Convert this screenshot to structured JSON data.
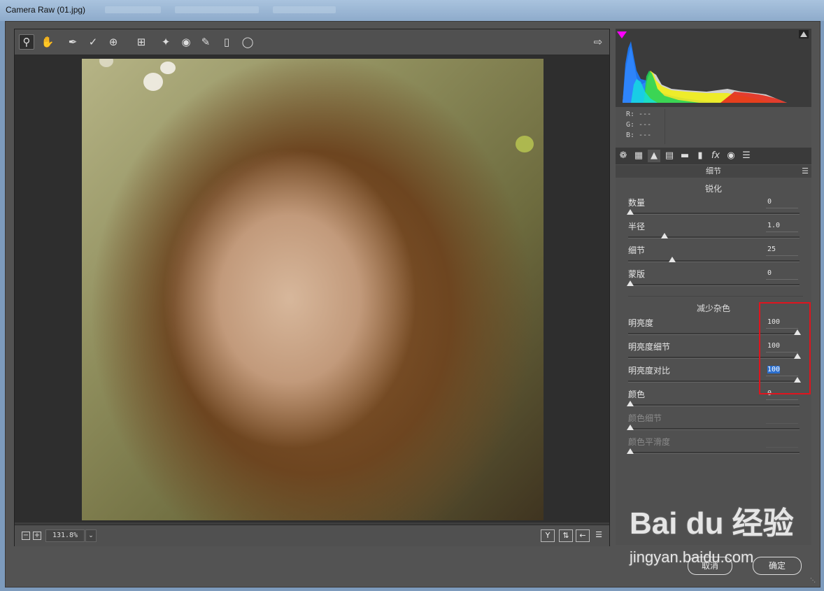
{
  "window": {
    "title": "Camera Raw (01.jpg)"
  },
  "toolbar": {
    "tools": [
      "zoom-tool",
      "hand-tool",
      "white-balance-tool",
      "color-sampler-tool",
      "targeted-adjustment-tool",
      "crop-tool",
      "spot-removal-tool",
      "red-eye-removal-tool",
      "adjustment-brush-tool",
      "graduated-filter-tool",
      "radial-filter-tool"
    ],
    "open_preferences_icon": "export-icon"
  },
  "statusbar": {
    "zoom_value": "131.8%"
  },
  "rgb_readout": {
    "r": "R:  ---",
    "g": "G:  ---",
    "b": "B:  ---"
  },
  "panel": {
    "title": "细节",
    "sharpen": {
      "heading": "锐化",
      "sliders": [
        {
          "label": "数量",
          "value": "0",
          "pos": 0.0
        },
        {
          "label": "半径",
          "value": "1.0",
          "pos": 0.2
        },
        {
          "label": "细节",
          "value": "25",
          "pos": 0.25
        },
        {
          "label": "蒙版",
          "value": "0",
          "pos": 0.0
        }
      ]
    },
    "noise": {
      "heading": "减少杂色",
      "sliders": [
        {
          "label": "明亮度",
          "value": "100",
          "pos": 1.0
        },
        {
          "label": "明亮度细节",
          "value": "100",
          "pos": 1.0
        },
        {
          "label": "明亮度对比",
          "value": "100",
          "pos": 1.0
        },
        {
          "label": "颜色",
          "value": "0",
          "pos": 0.0
        },
        {
          "label": "颜色细节",
          "value": "",
          "pos": 0.0
        },
        {
          "label": "颜色平滑度",
          "value": "",
          "pos": 0.0
        }
      ]
    }
  },
  "footer": {
    "cancel_label": "取消",
    "ok_label": "确定"
  },
  "watermark": {
    "logo": "Bai du 经验",
    "url": "jingyan.baidu.com"
  },
  "colors": {
    "highlight": "#e0141e",
    "selection": "#2b6fcf"
  }
}
